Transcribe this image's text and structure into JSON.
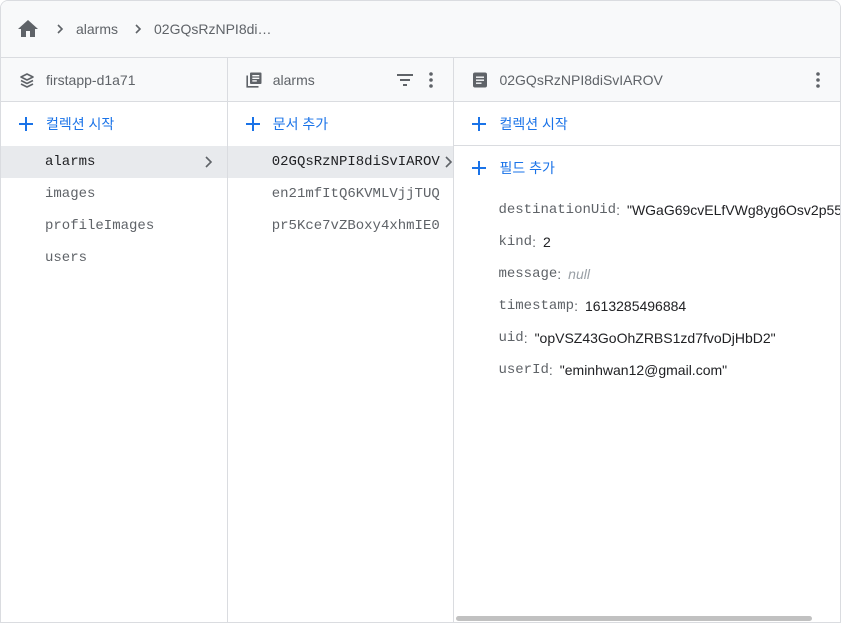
{
  "breadcrumb": {
    "home_icon": "home-icon",
    "items": [
      "alarms",
      "02GQsRzNPI8di…"
    ]
  },
  "project_panel": {
    "title": "firstapp-d1a71",
    "icon": "firebase-project-icon",
    "add_label": "컬렉션 시작",
    "collections": [
      "alarms",
      "images",
      "profileImages",
      "users"
    ],
    "selected_index": 0
  },
  "collection_panel": {
    "title": "alarms",
    "icon": "collection-icon",
    "add_label": "문서 추가",
    "documents": [
      "02GQsRzNPI8diSvIAROV",
      "en21mfItQ6KVMLVjjTUQ",
      "pr5Kce7vZBoxy4xhmIE0"
    ],
    "selected_index": 0
  },
  "document_panel": {
    "title": "02GQsRzNPI8diSvIAROV",
    "icon": "document-icon",
    "add_collection_label": "컬렉션 시작",
    "add_field_label": "필드 추가",
    "fields": [
      {
        "key": "destinationUid",
        "value": "\"WGaG69cvELfVWg8yg6Osv2p55",
        "is_null": false
      },
      {
        "key": "kind",
        "value": "2",
        "is_null": false
      },
      {
        "key": "message",
        "value": "null",
        "is_null": true
      },
      {
        "key": "timestamp",
        "value": "1613285496884",
        "is_null": false
      },
      {
        "key": "uid",
        "value": "\"opVSZ43GoOhZRBS1zd7fvoDjHbD2\"",
        "is_null": false
      },
      {
        "key": "userId",
        "value": "\"eminhwan12@gmail.com\"",
        "is_null": false
      }
    ]
  },
  "colors": {
    "accent": "#1a73e8",
    "selected_bg": "#e8eaed",
    "header_bg": "#f8f9fa",
    "border": "#dadce0"
  }
}
